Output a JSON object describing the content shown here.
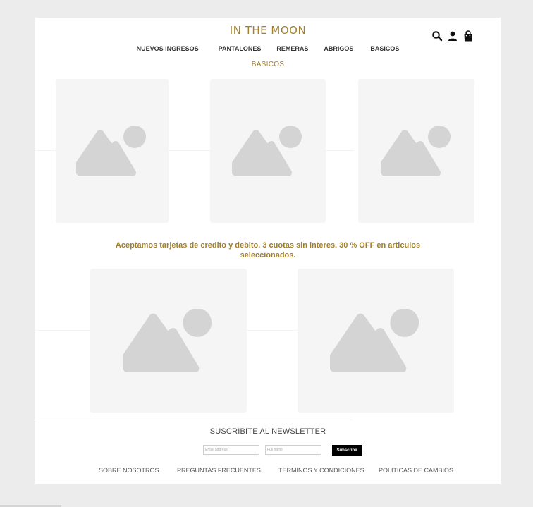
{
  "brand": "IN THE MOON",
  "header_icons": [
    "search-icon",
    "user-icon",
    "shopping-bag-icon"
  ],
  "nav": [
    "NUEVOS INGRESOS",
    "PANTALONES",
    "REMERAS",
    "ABRIGOS",
    "BASICOS"
  ],
  "page_title": "BASICOS",
  "promo": "Aceptamos tarjetas de credito y debito. 3 cuotas sin interes. 30 % OFF en articulos seleccionados.",
  "newsletter": {
    "title": "SUSCRIBITE AL NEWSLETTER",
    "email_placeholder": "Email address",
    "name_placeholder": "Full name",
    "button": "Subscribe"
  },
  "footer_links": [
    "SOBRE NOSOTROS",
    "PREGUNTAS FRECUENTES",
    "TERMINOS Y CONDICIONES",
    "POLITICAS DE CAMBIOS"
  ],
  "colors": {
    "accent": "#a0802a",
    "placeholder_bg": "#f5f5f5",
    "placeholder_icon": "#d4d4d4",
    "page_bg": "#ececec"
  }
}
